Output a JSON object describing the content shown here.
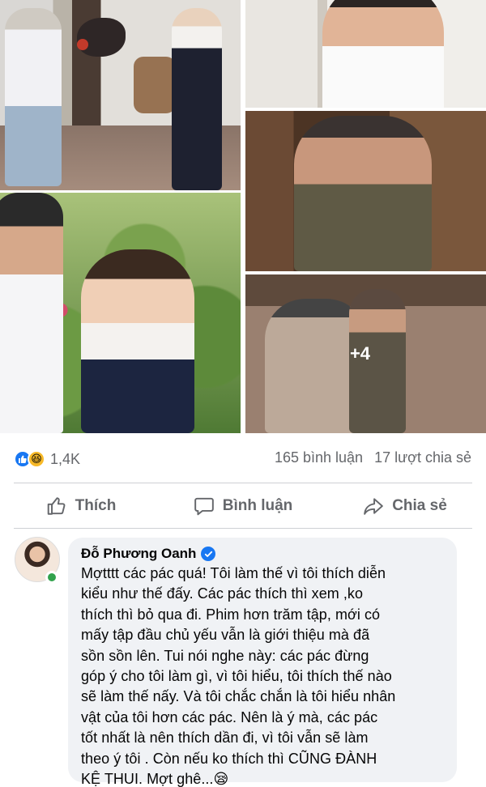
{
  "post": {
    "photos": [
      {
        "id": "photo-1",
        "alt": ""
      },
      {
        "id": "photo-2",
        "alt": ""
      },
      {
        "id": "photo-3",
        "alt": ""
      },
      {
        "id": "photo-4",
        "alt": ""
      },
      {
        "id": "photo-5",
        "alt": ""
      }
    ],
    "more_photos_label": "+4"
  },
  "stats": {
    "reaction_count": "1,4K",
    "comments": "165 bình luận",
    "shares": "17 lượt chia sẻ",
    "reaction_icons": [
      "like-icon",
      "haha-icon"
    ]
  },
  "actions": {
    "like_label": "Thích",
    "comment_label": "Bình luận",
    "share_label": "Chia sẻ"
  },
  "comment": {
    "author": "Đỗ Phương Oanh",
    "verified": true,
    "text": "Mợtttt các pác quá! Tôi làm thế vì tôi thích diễn\nkiểu như thế đấy. Các pác thích thì xem ,ko\nthích thì bỏ qua đi.  Phim hơn trăm tập, mới có\nmấy tập đầu chủ yếu vẫn là giới thiệu mà đã\nsồn sồn lên. Tui nói nghe này: các pác đừng\ngóp ý cho tôi làm gì, vì tôi hiểu, tôi thích thế nào\nsẽ làm thế nấy. Và tôi chắc chắn là tôi hiểu nhân\nvật của tôi hơn các pác. Nên là ý mà, các pác\ntốt nhất là nên thích dần đi, vì tôi vẫn sẽ làm\ntheo ý tôi . Còn nếu ko thích thì CŨNG ĐÀNH\nKỆ THUI. Mợt ghê...😪"
  },
  "colors": {
    "accent": "#1877f2",
    "muted_text": "#65676b",
    "bubble_bg": "#f0f2f5",
    "online": "#31a24c"
  }
}
